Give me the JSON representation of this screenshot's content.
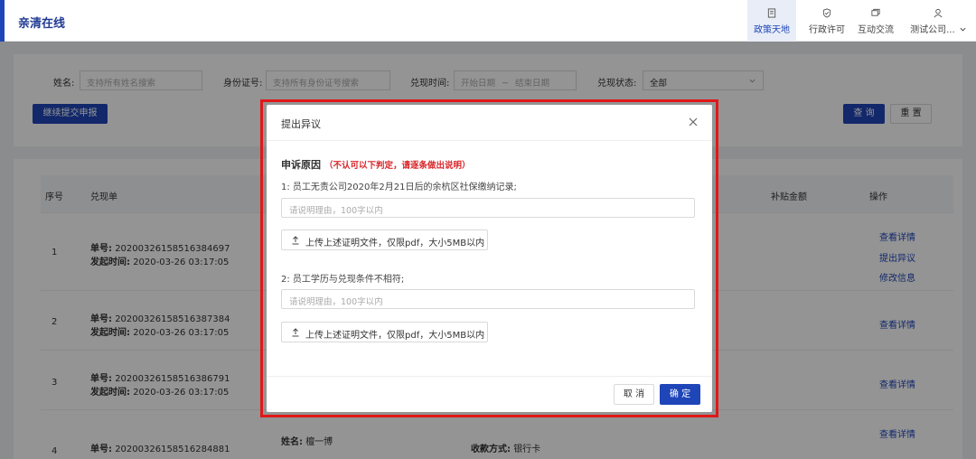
{
  "app": {
    "brand": "亲清在线"
  },
  "nav": [
    {
      "label": "政策天地",
      "icon": "document-icon",
      "active": true
    },
    {
      "label": "行政许可",
      "icon": "shield-icon",
      "active": false
    },
    {
      "label": "互动交流",
      "icon": "chat-icon",
      "active": false
    },
    {
      "label": "测试公司...",
      "icon": "user-icon",
      "active": false
    }
  ],
  "filters": {
    "name_label": "姓名:",
    "name_placeholder": "支持所有姓名搜索",
    "id_label": "身份证号:",
    "id_placeholder": "支持所有身份证号搜索",
    "time_label": "兑现时间:",
    "start_placeholder": "开始日期",
    "tilde": "~",
    "end_placeholder": "结束日期",
    "status_label": "兑现状态:",
    "status_value": "全部",
    "continue_button": "继续提交申报",
    "query_button": "查 询",
    "reset_button": "重 置"
  },
  "table": {
    "headers": {
      "index": "序号",
      "order": "兑现单",
      "subsidy": "补贴金额",
      "actions": "操作"
    },
    "order_label": "单号:",
    "time_label": "发起时间:",
    "rows": [
      {
        "index": "1",
        "order_no": "20200326158516384697",
        "time": "2020-03-26 03:17:05",
        "actions": [
          "查看详情",
          "提出异议",
          "修改信息"
        ]
      },
      {
        "index": "2",
        "order_no": "20200326158516387384",
        "time": "2020-03-26 03:17:05",
        "actions": [
          "查看详情"
        ]
      },
      {
        "index": "3",
        "order_no": "20200326158516386791",
        "time": "2020-03-26 03:17:05",
        "actions": [
          "查看详情"
        ]
      },
      {
        "index": "4",
        "order_no": "20200326158516284881",
        "name_label": "姓名:",
        "name": "檀一博",
        "pay_label": "收款方式:",
        "pay": "银行卡",
        "actions": [
          "查看详情"
        ]
      }
    ]
  },
  "modal": {
    "title": "提出异议",
    "reason_title": "申诉原因",
    "reason_note": "（不认可以下判定，请逐条做出说明）",
    "items": [
      {
        "question": "1:  员工无责公司2020年2月21日后的余杭区社保缴纳记录;",
        "placeholder": "请说明理由，100字以内",
        "upload": "上传上述证明文件，仅限pdf，大小5MB以内"
      },
      {
        "question": "2:  员工学历与兑现条件不相符;",
        "placeholder": "请说明理由，100字以内",
        "upload": "上传上述证明文件，仅限pdf，大小5MB以内"
      }
    ],
    "cancel": "取 消",
    "ok": "确 定"
  },
  "colors": {
    "primary": "#1f46b8",
    "highlight": "#e01818",
    "note": "#d8262a"
  }
}
